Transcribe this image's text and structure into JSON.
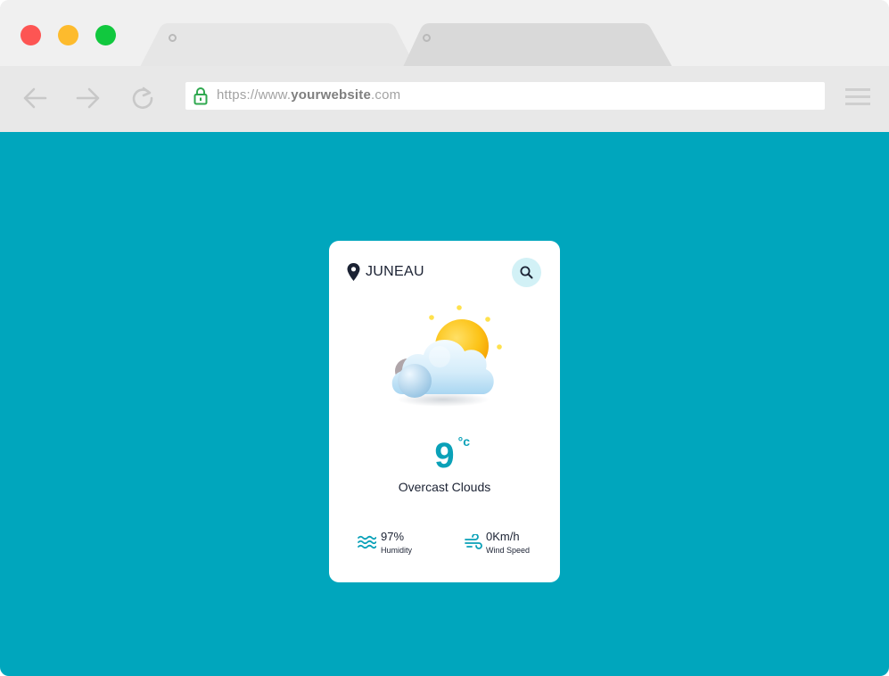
{
  "browser": {
    "url_scheme": "https://www.",
    "url_host": "yourwebsite",
    "url_tld": ".com",
    "icons": {
      "back": "arrow-left-icon",
      "forward": "arrow-right-icon",
      "reload": "reload-icon",
      "lock": "lock-icon",
      "menu": "hamburger-menu-icon"
    }
  },
  "weather": {
    "city": "JUNEAU",
    "temperature": "9",
    "unit": "°c",
    "description": "Overcast Clouds",
    "humidity": {
      "value": "97%",
      "label": "Humidity"
    },
    "wind": {
      "value": "0Km/h",
      "label": "Wind Speed"
    },
    "icons": {
      "location": "map-pin-icon",
      "search": "search-icon",
      "weather": "sun-behind-cloud-icon",
      "humidity": "waves-icon",
      "wind": "wind-icon"
    }
  },
  "colors": {
    "page_background": "#00a6bd",
    "accent": "#0aa1b8",
    "text_dark": "#1b2233"
  }
}
